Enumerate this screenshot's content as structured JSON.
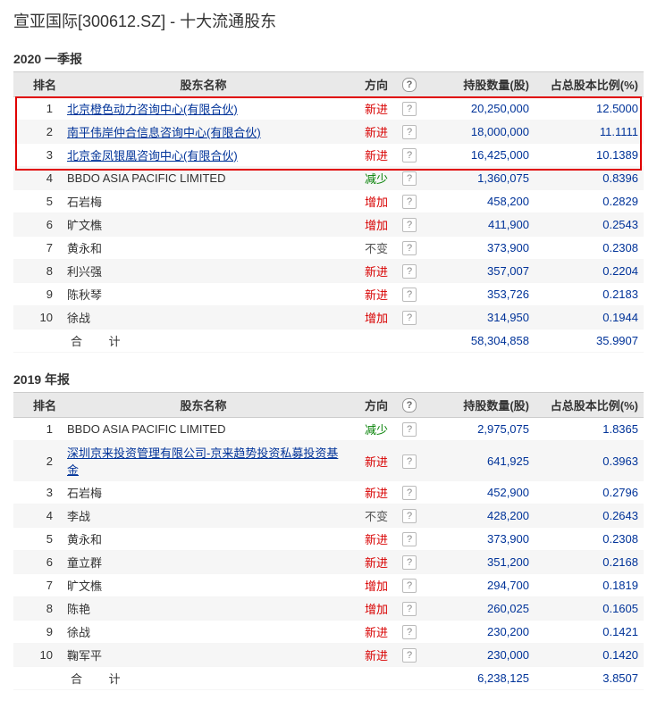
{
  "page_title": "宣亚国际[300612.SZ] - 十大流通股东",
  "columns": {
    "rank": "排名",
    "name": "股东名称",
    "dir": "方向",
    "qty": "持股数量(股)",
    "pct": "占总股本比例(%)"
  },
  "total_label": "合 计",
  "sections": [
    {
      "title": "2020 一季报",
      "highlight_first_n": 3,
      "total": {
        "qty": "58,304,858",
        "pct": "35.9907"
      },
      "rows": [
        {
          "rank": 1,
          "name": "北京橙色动力咨询中心(有限合伙)",
          "link": true,
          "dir_key": "new",
          "qty": "20,250,000",
          "pct": "12.5000"
        },
        {
          "rank": 2,
          "name": "南平伟岸仲合信息咨询中心(有限合伙)",
          "link": true,
          "dir_key": "new",
          "qty": "18,000,000",
          "pct": "11.1111"
        },
        {
          "rank": 3,
          "name": "北京金凤银凰咨询中心(有限合伙)",
          "link": true,
          "dir_key": "new",
          "qty": "16,425,000",
          "pct": "10.1389"
        },
        {
          "rank": 4,
          "name": "BBDO ASIA PACIFIC LIMITED",
          "link": false,
          "dir_key": "less",
          "qty": "1,360,075",
          "pct": "0.8396"
        },
        {
          "rank": 5,
          "name": "石岩梅",
          "link": false,
          "dir_key": "add",
          "qty": "458,200",
          "pct": "0.2829"
        },
        {
          "rank": 6,
          "name": "旷文樵",
          "link": false,
          "dir_key": "add",
          "qty": "411,900",
          "pct": "0.2543"
        },
        {
          "rank": 7,
          "name": "黄永和",
          "link": false,
          "dir_key": "unchg",
          "qty": "373,900",
          "pct": "0.2308"
        },
        {
          "rank": 8,
          "name": "利兴强",
          "link": false,
          "dir_key": "new",
          "qty": "357,007",
          "pct": "0.2204"
        },
        {
          "rank": 9,
          "name": "陈秋琴",
          "link": false,
          "dir_key": "new",
          "qty": "353,726",
          "pct": "0.2183"
        },
        {
          "rank": 10,
          "name": "徐战",
          "link": false,
          "dir_key": "add",
          "qty": "314,950",
          "pct": "0.1944"
        }
      ]
    },
    {
      "title": "2019 年报",
      "highlight_first_n": 0,
      "total": {
        "qty": "6,238,125",
        "pct": "3.8507"
      },
      "rows": [
        {
          "rank": 1,
          "name": "BBDO ASIA PACIFIC LIMITED",
          "link": false,
          "dir_key": "less",
          "qty": "2,975,075",
          "pct": "1.8365"
        },
        {
          "rank": 2,
          "name": "深圳京来投资管理有限公司-京来趋势投资私募投资基金",
          "link": true,
          "dir_key": "new",
          "qty": "641,925",
          "pct": "0.3963"
        },
        {
          "rank": 3,
          "name": "石岩梅",
          "link": false,
          "dir_key": "new",
          "qty": "452,900",
          "pct": "0.2796"
        },
        {
          "rank": 4,
          "name": "李战",
          "link": false,
          "dir_key": "unchg",
          "qty": "428,200",
          "pct": "0.2643"
        },
        {
          "rank": 5,
          "name": "黄永和",
          "link": false,
          "dir_key": "new",
          "qty": "373,900",
          "pct": "0.2308"
        },
        {
          "rank": 6,
          "name": "童立群",
          "link": false,
          "dir_key": "new",
          "qty": "351,200",
          "pct": "0.2168"
        },
        {
          "rank": 7,
          "name": "旷文樵",
          "link": false,
          "dir_key": "add",
          "qty": "294,700",
          "pct": "0.1819"
        },
        {
          "rank": 8,
          "name": "陈艳",
          "link": false,
          "dir_key": "add",
          "qty": "260,025",
          "pct": "0.1605"
        },
        {
          "rank": 9,
          "name": "徐战",
          "link": false,
          "dir_key": "new",
          "qty": "230,200",
          "pct": "0.1421"
        },
        {
          "rank": 10,
          "name": "鞠军平",
          "link": false,
          "dir_key": "new",
          "qty": "230,000",
          "pct": "0.1420"
        }
      ]
    }
  ],
  "dir_labels": {
    "new": "新进",
    "add": "增加",
    "less": "减少",
    "unchg": "不变"
  }
}
